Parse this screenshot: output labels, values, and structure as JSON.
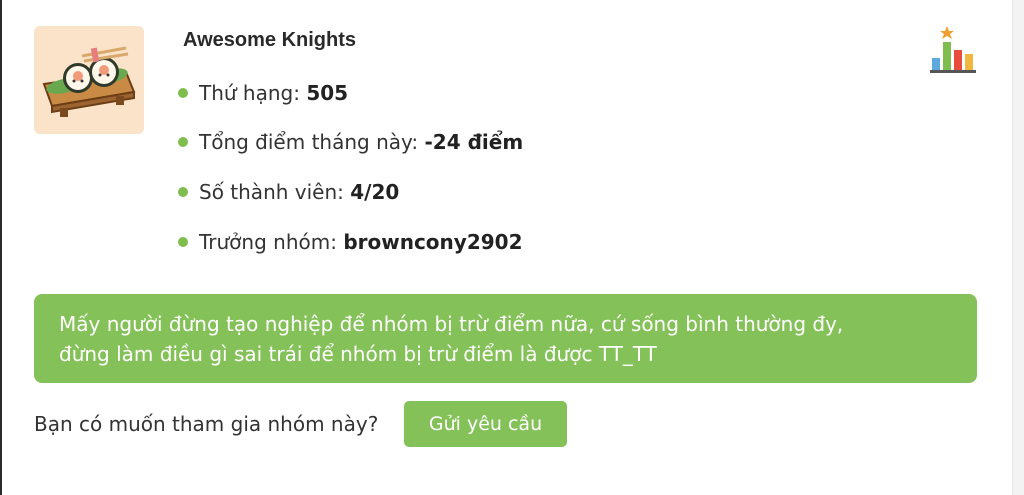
{
  "group": {
    "name": "Awesome Knights",
    "avatar_icon": "sushi-illustration",
    "info": [
      {
        "label": "Thứ hạng: ",
        "value": "505"
      },
      {
        "label": "Tổng điểm tháng này: ",
        "value": "-24 điểm"
      },
      {
        "label": "Số thành viên: ",
        "value": "4/20"
      },
      {
        "label": "Trưởng nhóm: ",
        "value": "browncony2902"
      }
    ],
    "rank_icon": "leaderboard-chart-icon"
  },
  "note": {
    "text": "Mấy người đừng tạo nghiệp để nhóm bị trừ điểm nữa, cứ sống bình thường đy, đừng làm điều gì sai trái để nhóm bị trừ điểm là được TT_TT"
  },
  "join": {
    "question": "Bạn có muốn tham gia nhóm này?",
    "button_label": "Gửi yêu cầu"
  },
  "colors": {
    "accent_green": "#84c158",
    "bullet_green": "#7fbd4e"
  }
}
